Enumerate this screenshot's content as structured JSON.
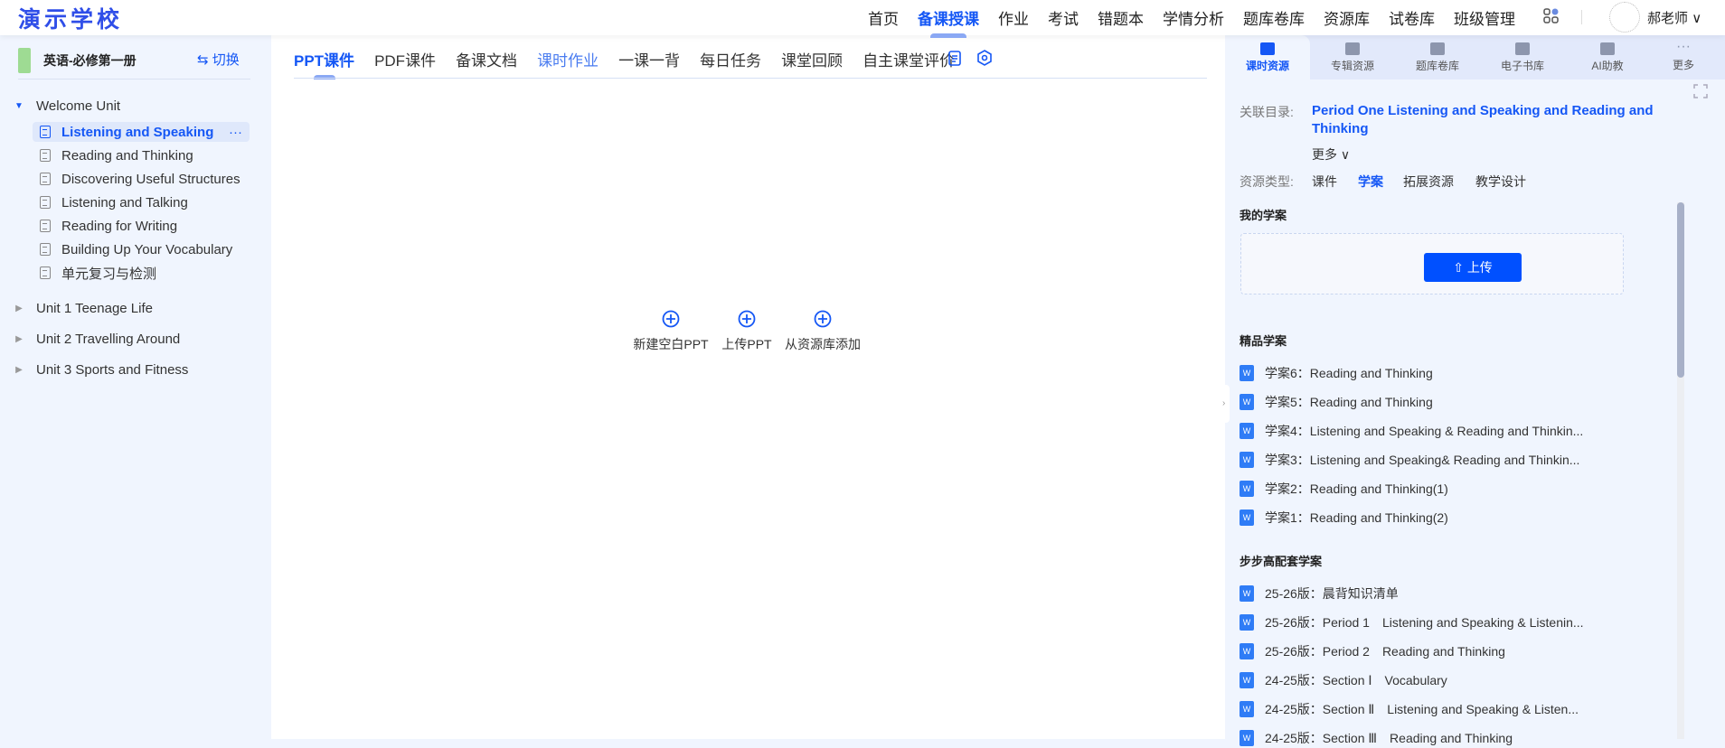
{
  "header": {
    "logo": "演示学校",
    "nav": [
      "首页",
      "备课授课",
      "作业",
      "考试",
      "错题本",
      "学情分析",
      "题库卷库",
      "资源库",
      "试卷库",
      "班级管理"
    ],
    "active_nav": 1,
    "user": "郝老师"
  },
  "sidebar": {
    "book": "英语-必修第一册",
    "switch": "切换",
    "welcome": "Welcome Unit",
    "lessons": [
      "Listening and Speaking",
      "Reading and Thinking",
      "Discovering Useful Structures",
      "Listening and Talking",
      "Reading for Writing",
      "Building Up Your Vocabulary",
      "单元复习与检测"
    ],
    "units": [
      "Unit 1 Teenage Life",
      "Unit 2 Travelling Around",
      "Unit 3 Sports and Fitness"
    ],
    "more": "···"
  },
  "main": {
    "tabs": [
      "PPT课件",
      "PDF课件",
      "备课文档",
      "课时作业",
      "一课一背",
      "每日任务",
      "课堂回顾",
      "自主课堂评价"
    ],
    "actions": [
      "新建空白PPT",
      "上传PPT",
      "从资源库添加"
    ]
  },
  "right": {
    "tabs": [
      "课时资源",
      "专辑资源",
      "题库卷库",
      "电子书库",
      "AI助教",
      "更多"
    ],
    "related_label": "关联目录:",
    "related": "Period One Listening and Speaking and Reading and Thinking",
    "more": "更多",
    "type_label": "资源类型:",
    "types": [
      "课件",
      "学案",
      "拓展资源",
      "教学设计"
    ],
    "my_title": "我的学案",
    "upload": "上传",
    "premium_title": "精品学案",
    "premium": [
      "学案6：Reading and Thinking",
      "学案5：Reading and Thinking",
      "学案4：Listening and Speaking & Reading and Thinkin...",
      "学案3：Listening and Speaking& Reading and Thinkin...",
      "学案2：Reading and Thinking(1)",
      "学案1：Reading and Thinking(2)"
    ],
    "bbg_title": "步步高配套学案",
    "bbg": [
      "25-26版：晨背知识清单",
      "25-26版：Period 1　Listening and Speaking & Listenin...",
      "25-26版：Period 2　Reading and Thinking",
      "24-25版：Section Ⅰ　Vocabulary",
      "24-25版：Section Ⅱ　Listening and Speaking & Listen...",
      "24-25版：Section Ⅲ　Reading and Thinking"
    ]
  },
  "colors": {
    "accent": "#1557f5",
    "button": "#0050ff"
  }
}
